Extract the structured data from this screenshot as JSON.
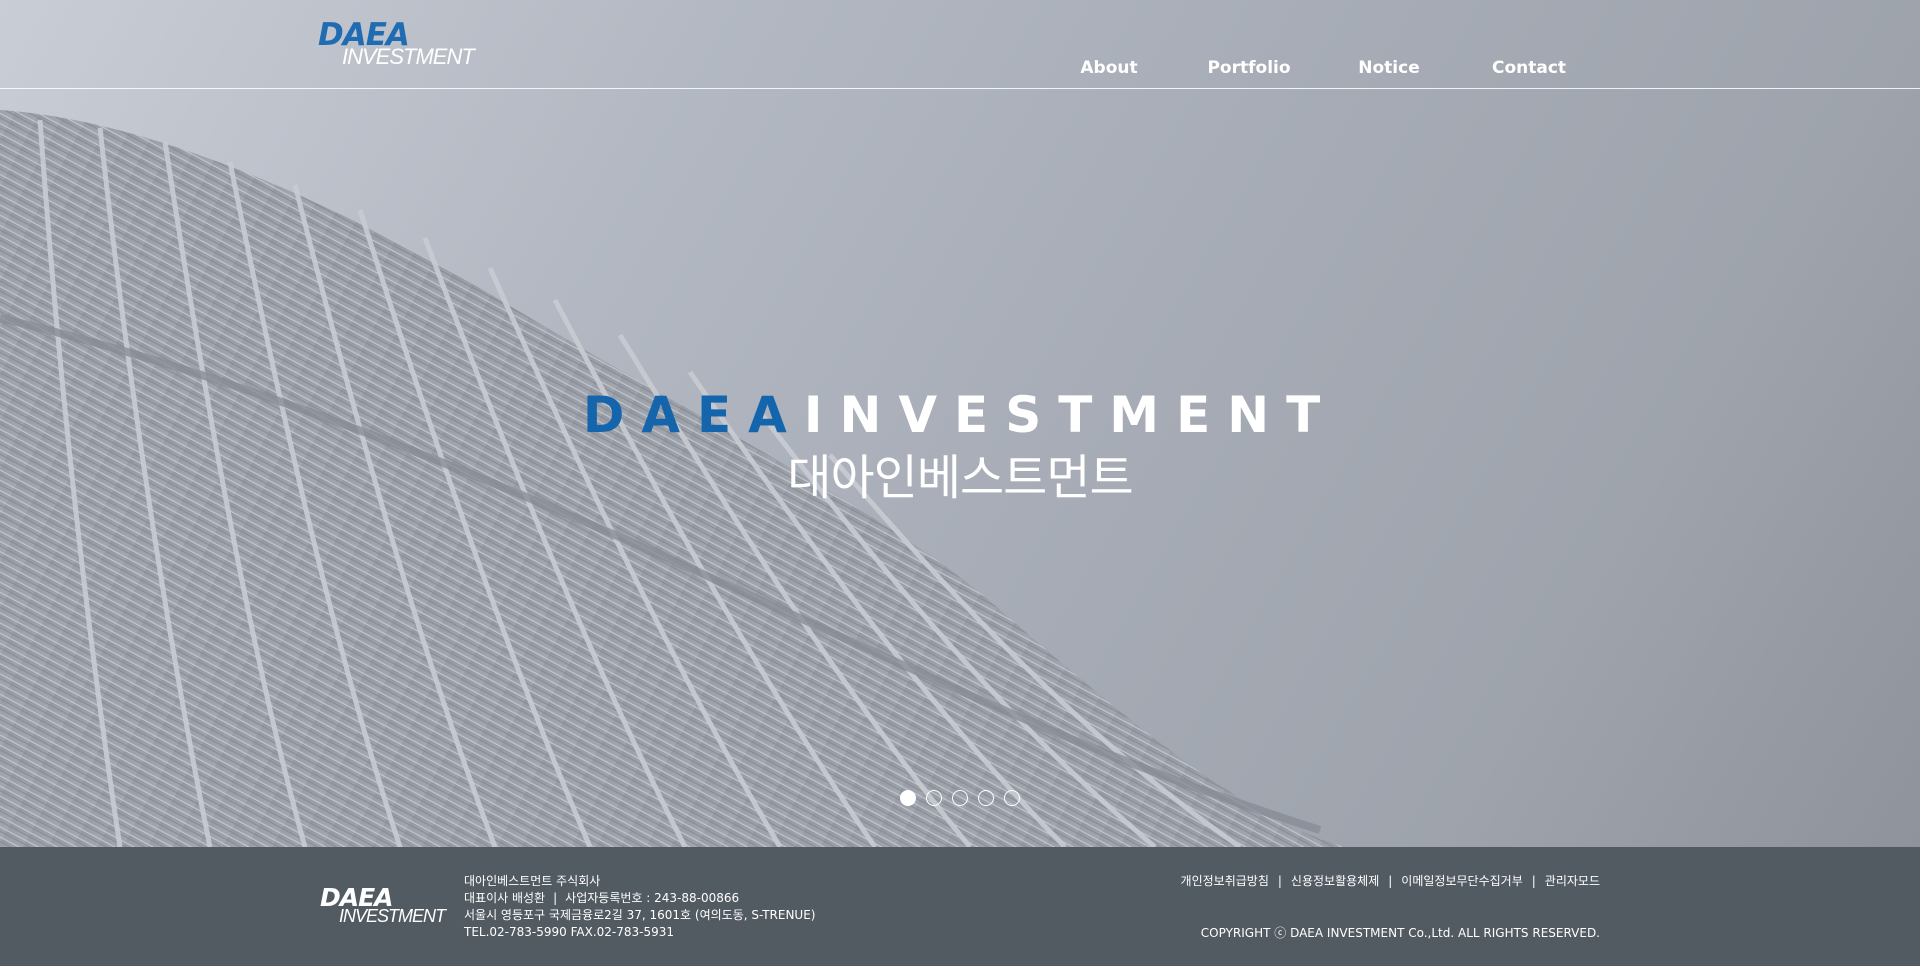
{
  "header": {
    "logo": {
      "top": "DAEA",
      "bottom": "INVESTMENT"
    },
    "nav": [
      {
        "label": "About"
      },
      {
        "label": "Portfolio"
      },
      {
        "label": "Notice"
      },
      {
        "label": "Contact"
      }
    ]
  },
  "hero": {
    "title_blue": "DAEA",
    "title_white": "INVESTMENT",
    "subtitle": "대아인베스트먼트",
    "slides": 5,
    "active_slide": 1
  },
  "footer": {
    "logo": {
      "top": "DAEA",
      "bottom": "INVESTMENT"
    },
    "company": "대아인베스트먼트 주식회사",
    "ceo": "대표이사 배성환",
    "separator": "|",
    "business_no": "사업자등록번호 : 243-88-00866",
    "address": "서울시 영등포구 국제금융로2길 37, 1601호 (여의도동, S-TRENUE)",
    "contact": "TEL.02-783-5990 FAX.02-783-5931",
    "links": [
      {
        "label": "개인정보취급방침"
      },
      {
        "label": "신용정보활용체제"
      },
      {
        "label": "이메일정보무단수집거부"
      },
      {
        "label": "관리자모드"
      }
    ],
    "copyright": "COPYRIGHT ⓒ DAEA INVESTMENT Co.,Ltd. ALL RIGHTS RESERVED."
  },
  "colors": {
    "brand_blue": "#1565ad",
    "footer_bg": "#525a62",
    "text_white": "#ffffff"
  }
}
